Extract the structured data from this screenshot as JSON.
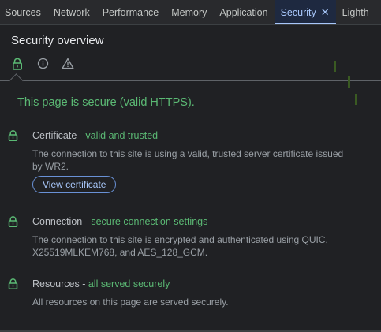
{
  "tabs": [
    {
      "label": "Sources",
      "active": false
    },
    {
      "label": "Network",
      "active": false
    },
    {
      "label": "Performance",
      "active": false
    },
    {
      "label": "Memory",
      "active": false
    },
    {
      "label": "Application",
      "active": false
    },
    {
      "label": "Security",
      "active": true,
      "closable": true
    },
    {
      "label": "Lighth",
      "active": false
    }
  ],
  "header": {
    "title": "Security overview",
    "icons": [
      "lock-icon",
      "info-icon",
      "warning-icon"
    ]
  },
  "main": {
    "summary": "This page is secure (valid HTTPS).",
    "sections": [
      {
        "name": "Certificate",
        "separator": " - ",
        "status": "valid and trusted",
        "description": "The connection to this site is using a valid, trusted server certificate issued by WR2.",
        "button_label": "View certificate"
      },
      {
        "name": "Connection",
        "separator": " - ",
        "status": "secure connection settings",
        "description": "The connection to this site is encrypted and authenticated using QUIC, X25519MLKEM768, and AES_128_GCM."
      },
      {
        "name": "Resources",
        "separator": " - ",
        "status": "all served securely",
        "description": "All resources on this page are served securely."
      }
    ]
  },
  "colors": {
    "background": "#202124",
    "secure_green": "#5bb974",
    "accent_blue": "#a8c7fa",
    "active_tab_bg": "#1e2940"
  }
}
